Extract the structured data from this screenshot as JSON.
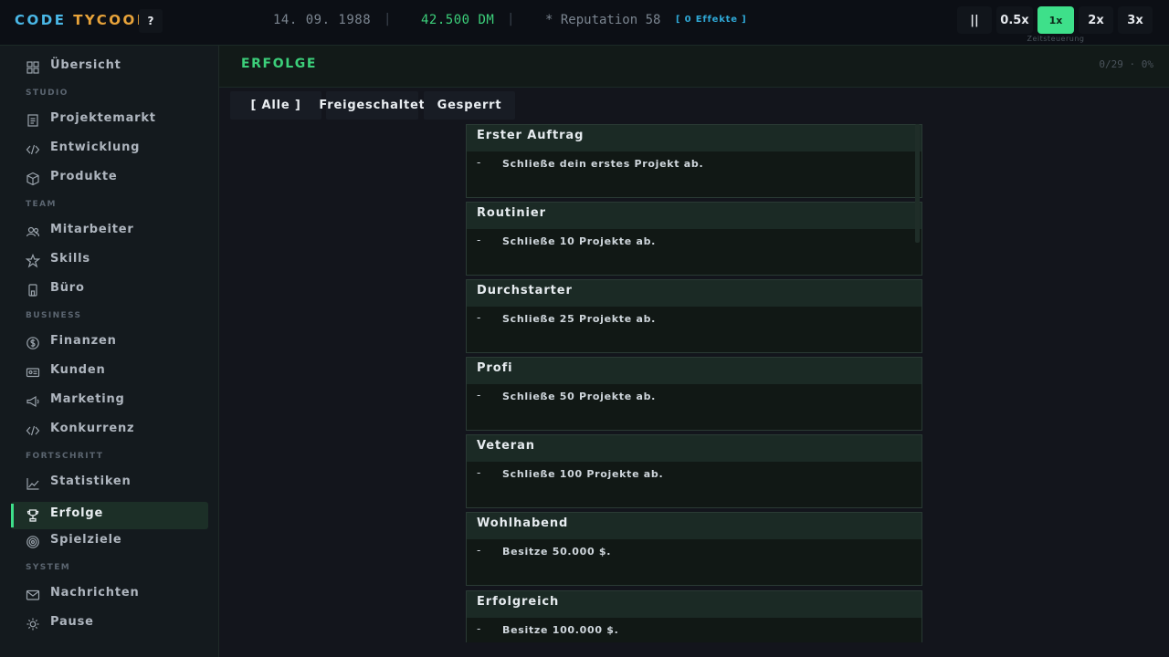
{
  "app": {
    "logo_part1": "CODE",
    "logo_part2": "TYCOON",
    "help_label": "?"
  },
  "topbar": {
    "date": "14. 09. 1988",
    "separator": "|",
    "money": "42.500 DM",
    "reputation": "* Reputation 58",
    "effects": "[ 0 Effekte ]"
  },
  "speed": {
    "pause_label": "||",
    "buttons": [
      "0.5x",
      "1x",
      "2x",
      "3x"
    ],
    "active": "1x",
    "caption": "Zeitsteuerung"
  },
  "sidebar": {
    "overview": "Übersicht",
    "sections": [
      {
        "label": "STUDIO",
        "items": [
          "Projektemarkt",
          "Entwicklung",
          "Produkte"
        ]
      },
      {
        "label": "TEAM",
        "items": [
          "Mitarbeiter",
          "Skills",
          "Büro"
        ]
      },
      {
        "label": "BUSINESS",
        "items": [
          "Finanzen",
          "Kunden",
          "Marketing",
          "Konkurrenz"
        ]
      },
      {
        "label": "FORTSCHRITT",
        "items": [
          "Statistiken",
          "Erfolge",
          "Spielziele"
        ]
      },
      {
        "label": "SYSTEM",
        "items": [
          "Nachrichten",
          "Pause"
        ]
      }
    ],
    "active_item": "Erfolge"
  },
  "main": {
    "title": "ERFOLGE",
    "progress": "0/29 · 0%",
    "filters": [
      "[ Alle ]",
      "Freigeschaltet",
      "Gesperrt"
    ],
    "active_filter": "[ Alle ]",
    "achievements": [
      {
        "title": "Erster Auftrag",
        "status": "-",
        "description": "Schließe dein erstes Projekt ab."
      },
      {
        "title": "Routinier",
        "status": "-",
        "description": "Schließe 10 Projekte ab."
      },
      {
        "title": "Durchstarter",
        "status": "-",
        "description": "Schließe 25 Projekte ab."
      },
      {
        "title": "Profi",
        "status": "-",
        "description": "Schließe 50 Projekte ab."
      },
      {
        "title": "Veteran",
        "status": "-",
        "description": "Schließe 100 Projekte ab."
      },
      {
        "title": "Wohlhabend",
        "status": "-",
        "description": "Besitze 50.000 $."
      },
      {
        "title": "Erfolgreich",
        "status": "-",
        "description": "Besitze 100.000 $."
      }
    ]
  },
  "colors": {
    "accent_green": "#3ee08a",
    "logo_blue": "#4ab7e6",
    "logo_orange": "#e8a33a",
    "effects_blue": "#2fa8d6"
  }
}
